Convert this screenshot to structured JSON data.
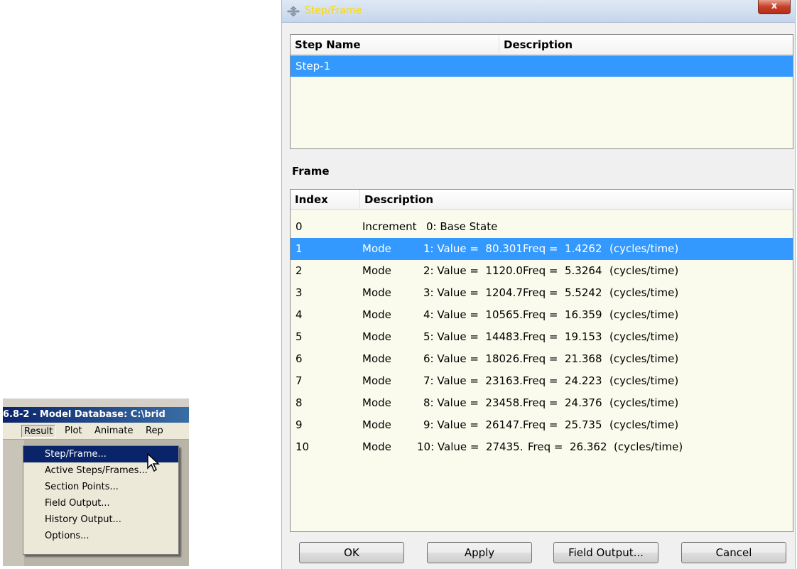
{
  "menu_snippet": {
    "window_title": "6.8-2 - Model Database: C:\\brid",
    "menubar": [
      "Result",
      "Plot",
      "Animate",
      "Rep"
    ],
    "menu_items": [
      {
        "label": "Step/Frame...",
        "highlighted": true
      },
      {
        "label": "Active Steps/Frames..."
      },
      {
        "label": "Section Points..."
      },
      {
        "label": "Field Output..."
      },
      {
        "label": "History Output..."
      },
      {
        "label": "Options..."
      }
    ]
  },
  "dialog": {
    "title": "Step/Frame",
    "close_label": "x",
    "step_table": {
      "headers": [
        "Step Name",
        "Description"
      ],
      "rows": [
        {
          "name": "Step-1",
          "description": ""
        }
      ]
    },
    "frame_label": "Frame",
    "frame_table": {
      "headers": [
        "Index",
        "Description"
      ],
      "rows": [
        {
          "index": "0",
          "type": "Increment",
          "value": "0: Base State",
          "freq": "",
          "unit": ""
        },
        {
          "index": "1",
          "type": "Mode",
          "value": "1: Value =  80.301",
          "freq": "Freq =  1.4262",
          "unit": "(cycles/time)"
        },
        {
          "index": "2",
          "type": "Mode",
          "value": "2: Value =  1120.0",
          "freq": "Freq =  5.3264",
          "unit": "(cycles/time)"
        },
        {
          "index": "3",
          "type": "Mode",
          "value": "3: Value =  1204.7",
          "freq": "Freq =  5.5242",
          "unit": "(cycles/time)"
        },
        {
          "index": "4",
          "type": "Mode",
          "value": "4: Value =  10565.",
          "freq": "Freq =  16.359",
          "unit": "(cycles/time)"
        },
        {
          "index": "5",
          "type": "Mode",
          "value": "5: Value =  14483.",
          "freq": "Freq =  19.153",
          "unit": "(cycles/time)"
        },
        {
          "index": "6",
          "type": "Mode",
          "value": "6: Value =  18026.",
          "freq": "Freq =  21.368",
          "unit": "(cycles/time)"
        },
        {
          "index": "7",
          "type": "Mode",
          "value": "7: Value =  23163.",
          "freq": "Freq =  24.223",
          "unit": "(cycles/time)"
        },
        {
          "index": "8",
          "type": "Mode",
          "value": "8: Value =  23458.",
          "freq": "Freq =  24.376",
          "unit": "(cycles/time)"
        },
        {
          "index": "9",
          "type": "Mode",
          "value": "9: Value =  26147.",
          "freq": "Freq =  25.735",
          "unit": "(cycles/time)"
        },
        {
          "index": "10",
          "type": "Mode",
          "value": "10: Value =  27435.",
          "freq": "Freq =  26.362",
          "unit": "(cycles/time)"
        }
      ],
      "selected_index": 1
    },
    "buttons": {
      "ok": "OK",
      "apply": "Apply",
      "field_output": "Field Output...",
      "cancel": "Cancel"
    }
  },
  "colors": {
    "selection": "#3399ff",
    "list_background": "#fbfbed",
    "title_text": "#ffd700"
  }
}
